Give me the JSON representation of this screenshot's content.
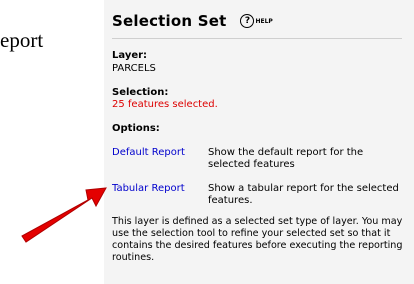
{
  "background": {
    "text": "eport"
  },
  "panel": {
    "title": "Selection Set",
    "help_label": "HELP",
    "layer": {
      "label": "Layer:",
      "value": "PARCELS"
    },
    "selection": {
      "label": "Selection:",
      "value": "25 features selected."
    },
    "options": {
      "label": "Options:",
      "items": [
        {
          "link": "Default Report",
          "description": "Show the default report for the selected features"
        },
        {
          "link": "Tabular Report",
          "description": "Show a tabular report for the selected features."
        }
      ]
    },
    "note": "This layer is defined as a selected set type of layer. You may use the selection tool to refine your selected set so that it contains the desired features before executing the reporting routines."
  },
  "colors": {
    "panel_bg": "#f4f4f4",
    "link": "#0000cc",
    "selection_value": "#dd0000",
    "arrow": "#e40000"
  }
}
